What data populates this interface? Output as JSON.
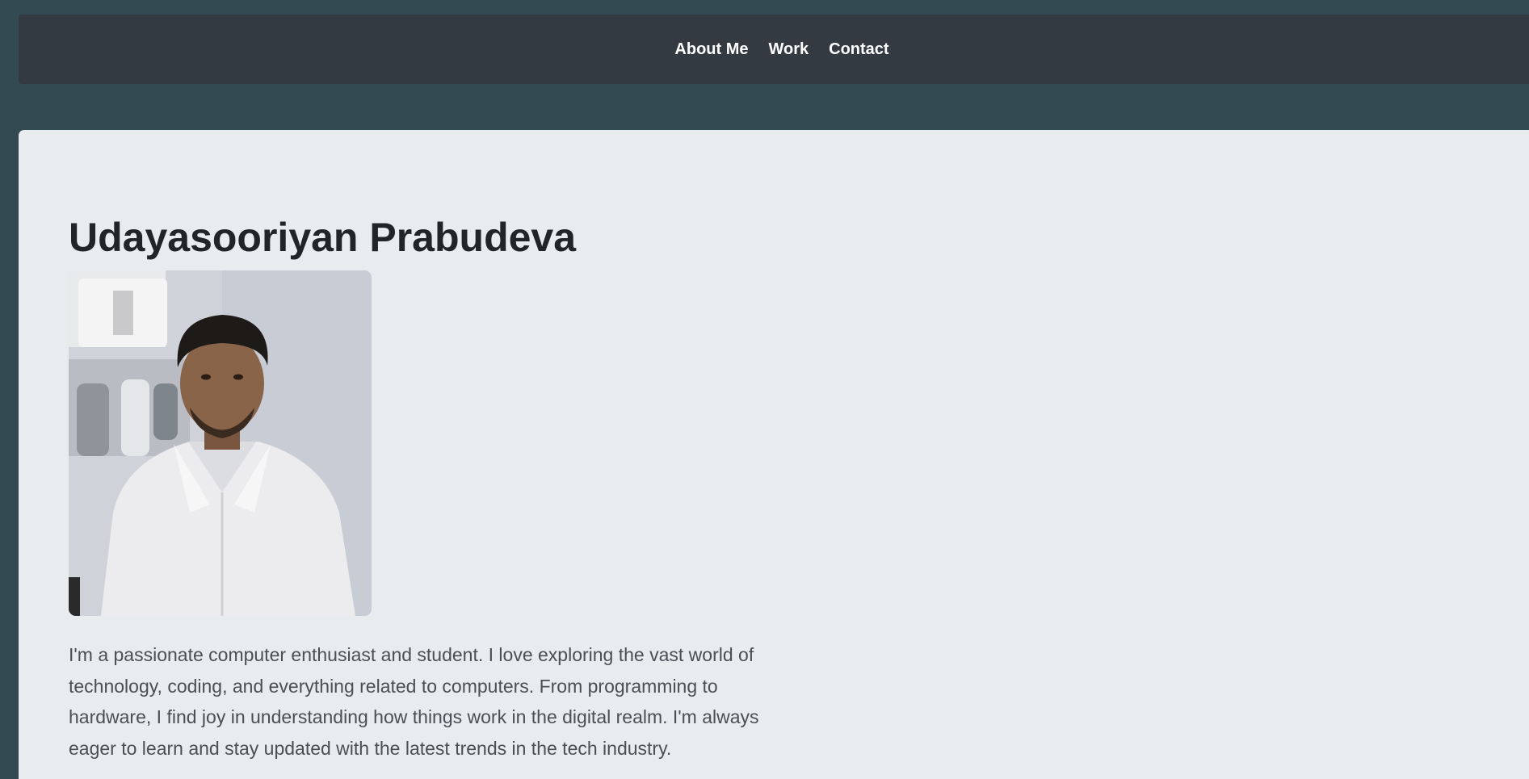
{
  "nav": {
    "items": [
      {
        "label": "About Me"
      },
      {
        "label": "Work"
      },
      {
        "label": "Contact"
      }
    ]
  },
  "profile": {
    "name": "Udayasooriyan Prabudeva",
    "photo_icon": "person-portrait",
    "bio": "I'm a passionate computer enthusiast and student. I love exploring the vast world of technology, coding, and everything related to computers. From programming to hardware, I find joy in understanding how things work in the digital realm. I'm always eager to learn and stay updated with the latest trends in the tech industry."
  },
  "colors": {
    "page_background": "#334a52",
    "navbar_background": "#343a42",
    "card_background": "#e8ecef",
    "heading_text": "#212529",
    "body_text": "#4a4f55",
    "nav_text": "#ffffff"
  }
}
